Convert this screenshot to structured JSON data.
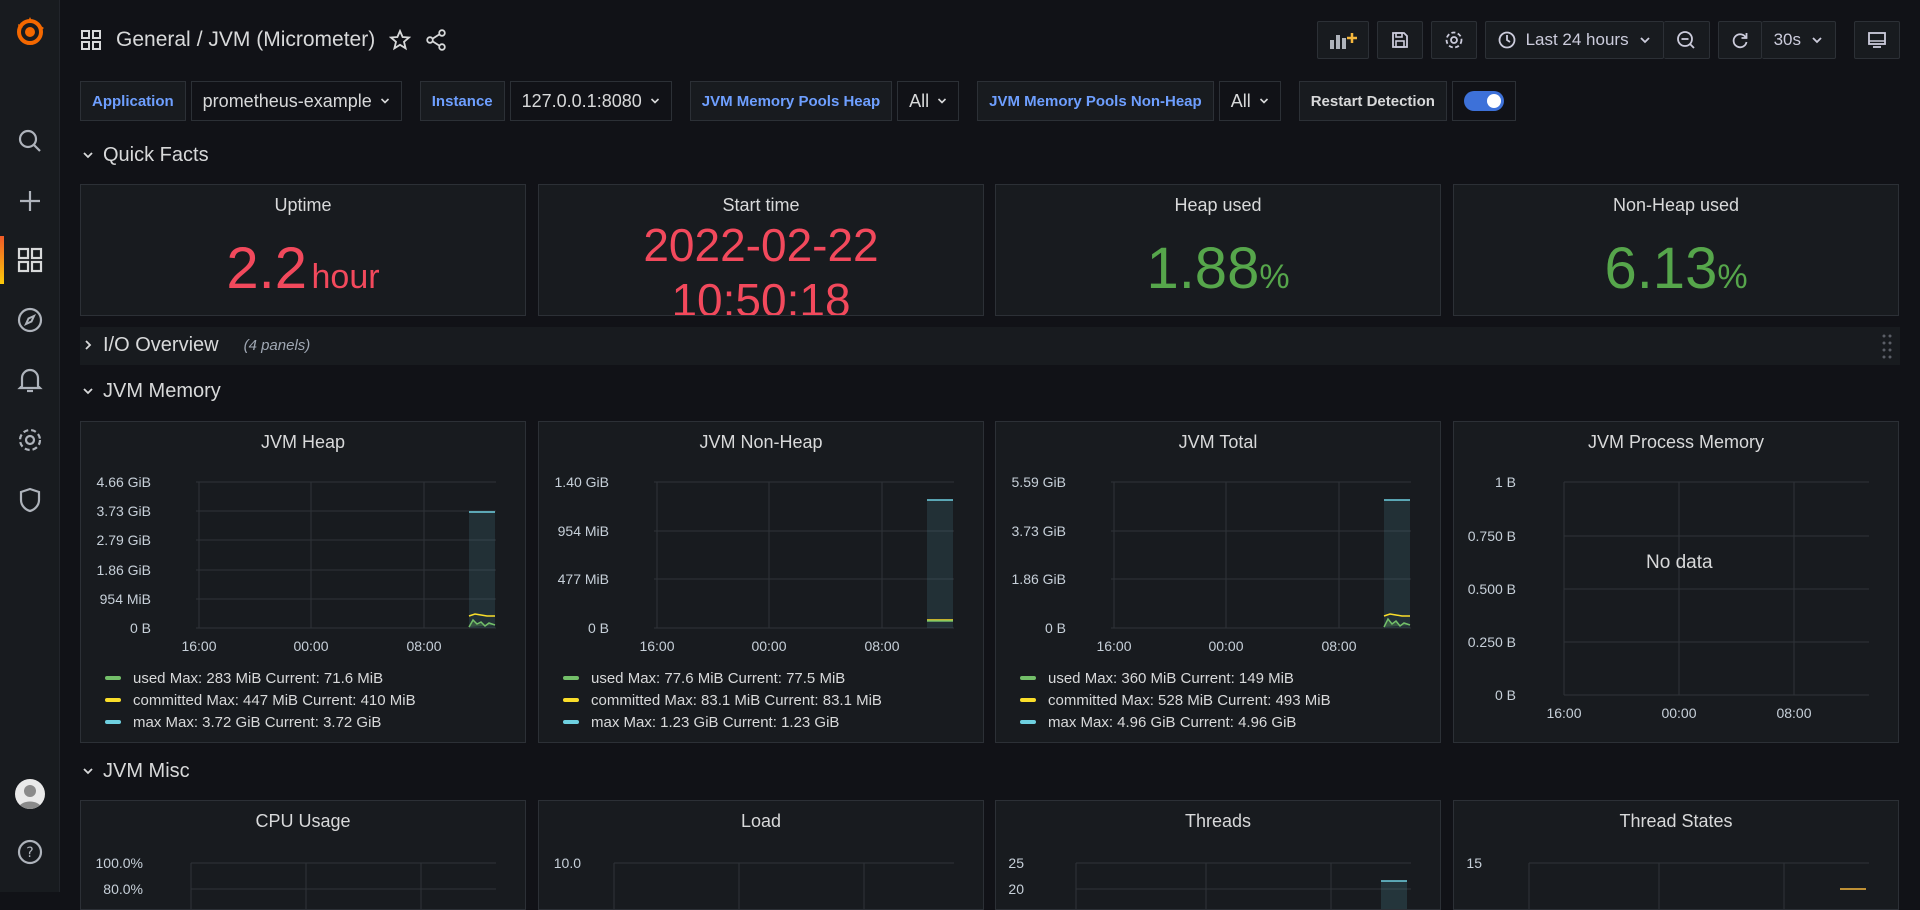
{
  "header": {
    "breadcrumb_folder": "General",
    "breadcrumb_dashboard": "/ JVM (Micrometer)",
    "time_range": "Last 24 hours",
    "refresh_interval": "30s"
  },
  "variables": [
    {
      "label": "Application",
      "value": "prometheus-example"
    },
    {
      "label": "Instance",
      "value": "127.0.0.1:8080"
    },
    {
      "label": "JVM Memory Pools Heap",
      "value": "All"
    },
    {
      "label": "JVM Memory Pools Non-Heap",
      "value": "All"
    }
  ],
  "restart_detection": {
    "label": "Restart Detection",
    "enabled": true
  },
  "rows": {
    "quick_facts": "Quick Facts",
    "io_overview": "I/O Overview",
    "io_overview_count": "(4 panels)",
    "jvm_memory": "JVM Memory",
    "jvm_misc": "JVM Misc"
  },
  "stats": {
    "uptime": {
      "title": "Uptime",
      "value": "2.2",
      "unit": "hour"
    },
    "start_time": {
      "title": "Start time",
      "date": "2022-02-22",
      "time": "10:50:18"
    },
    "heap_used": {
      "title": "Heap used",
      "value": "1.88",
      "unit": "%"
    },
    "nonheap_used": {
      "title": "Non-Heap used",
      "value": "6.13",
      "unit": "%"
    }
  },
  "colors": {
    "red": "#f2495c",
    "green": "#56a64b",
    "used": "#73bf69",
    "committed": "#fade2a",
    "max": "#8ab8ff",
    "max_line": "#6ed0e0",
    "accent": "#3d71d9"
  },
  "charts": {
    "jvm_heap": {
      "title": "JVM Heap",
      "yticks": [
        "4.66 GiB",
        "3.73 GiB",
        "2.79 GiB",
        "1.86 GiB",
        "954 MiB",
        "0 B"
      ],
      "xticks": [
        "16:00",
        "00:00",
        "08:00"
      ],
      "legend": [
        {
          "name": "used",
          "max": "283 MiB",
          "current": "71.6 MiB",
          "text": "used  Max: 283 MiB  Current: 71.6 MiB"
        },
        {
          "name": "committed",
          "max": "447 MiB",
          "current": "410 MiB",
          "text": "committed  Max: 447 MiB  Current: 410 MiB"
        },
        {
          "name": "max",
          "max": "3.72 GiB",
          "current": "3.72 GiB",
          "text": "max  Max: 3.72 GiB  Current: 3.72 GiB"
        }
      ]
    },
    "jvm_nonheap": {
      "title": "JVM Non-Heap",
      "yticks": [
        "1.40 GiB",
        "954 MiB",
        "477 MiB",
        "0 B"
      ],
      "xticks": [
        "16:00",
        "00:00",
        "08:00"
      ],
      "legend": [
        {
          "name": "used",
          "max": "77.6 MiB",
          "current": "77.5 MiB",
          "text": "used  Max: 77.6 MiB  Current: 77.5 MiB"
        },
        {
          "name": "committed",
          "max": "83.1 MiB",
          "current": "83.1 MiB",
          "text": "committed  Max: 83.1 MiB  Current: 83.1 MiB"
        },
        {
          "name": "max",
          "max": "1.23 GiB",
          "current": "1.23 GiB",
          "text": "max  Max: 1.23 GiB  Current: 1.23 GiB"
        }
      ]
    },
    "jvm_total": {
      "title": "JVM Total",
      "yticks": [
        "5.59 GiB",
        "3.73 GiB",
        "1.86 GiB",
        "0 B"
      ],
      "xticks": [
        "16:00",
        "00:00",
        "08:00"
      ],
      "legend": [
        {
          "name": "used",
          "max": "360 MiB",
          "current": "149 MiB",
          "text": "used  Max: 360 MiB  Current: 149 MiB"
        },
        {
          "name": "committed",
          "max": "528 MiB",
          "current": "493 MiB",
          "text": "committed  Max: 528 MiB  Current: 493 MiB"
        },
        {
          "name": "max",
          "max": "4.96 GiB",
          "current": "4.96 GiB",
          "text": "max  Max: 4.96 GiB  Current: 4.96 GiB"
        }
      ]
    },
    "jvm_process_memory": {
      "title": "JVM Process Memory",
      "yticks": [
        "1 B",
        "0.750 B",
        "0.500 B",
        "0.250 B",
        "0 B"
      ],
      "xticks": [
        "16:00",
        "00:00",
        "08:00"
      ],
      "no_data": "No data"
    },
    "cpu_usage": {
      "title": "CPU Usage",
      "ytick_top": "100.0%",
      "ytick_second": "80.0%"
    },
    "load": {
      "title": "Load",
      "ytick_top": "10.0"
    },
    "threads": {
      "title": "Threads",
      "ytick_top": "25",
      "ytick_second": "20"
    },
    "thread_states": {
      "title": "Thread States",
      "ytick_top": "15"
    }
  }
}
